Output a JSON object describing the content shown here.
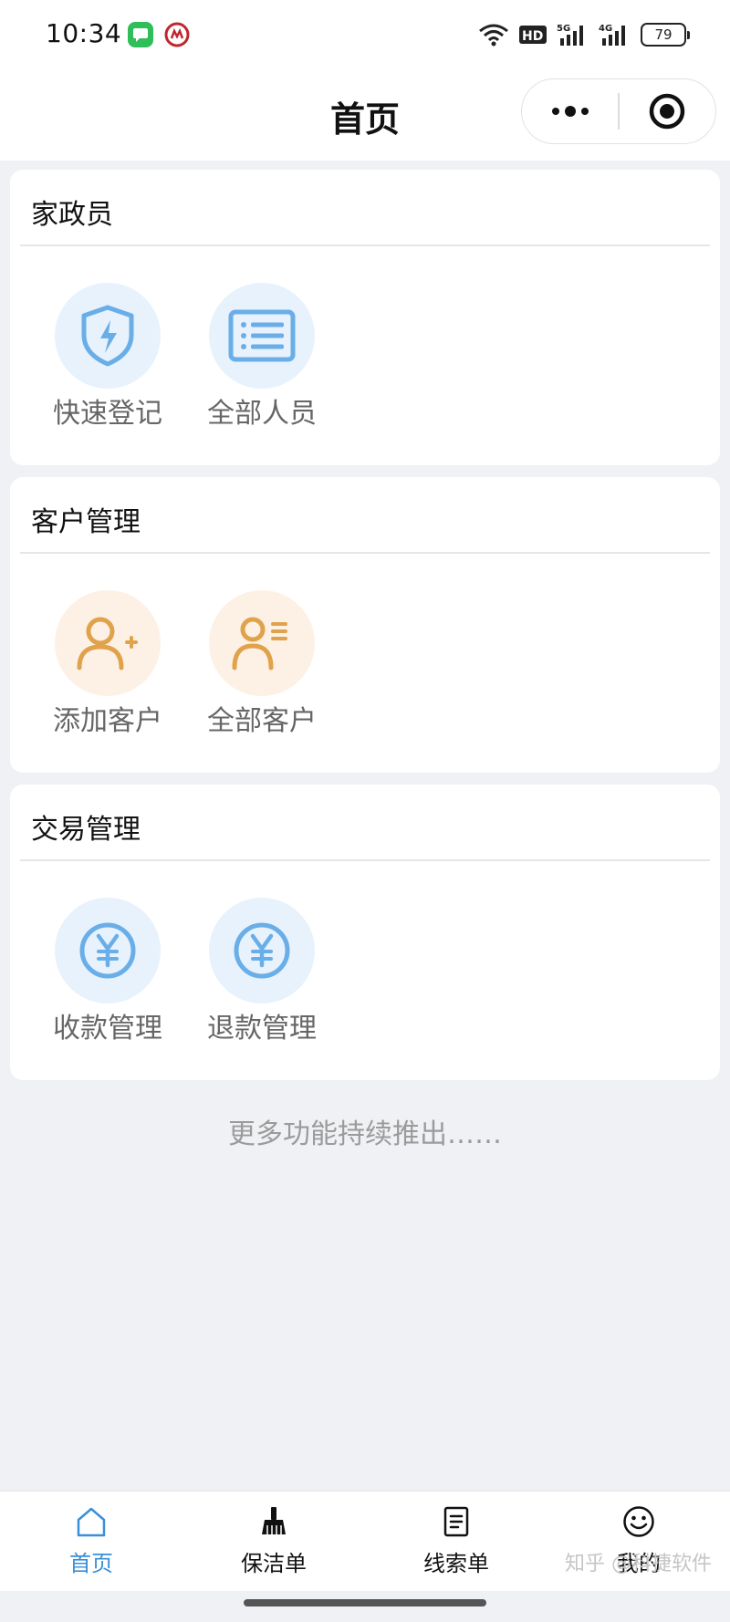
{
  "status_bar": {
    "time": "10:34",
    "battery": "79",
    "icons": [
      "message-app-icon",
      "bank-app-icon",
      "wifi-icon",
      "hd-icon",
      "signal-5g-icon",
      "signal-4g-icon",
      "battery-icon"
    ]
  },
  "nav": {
    "title": "首页",
    "capsule_icons": [
      "more-dots-icon",
      "close-target-icon"
    ]
  },
  "sections": [
    {
      "title": "家政员",
      "items": [
        {
          "label": "快速登记",
          "icon": "shield-bolt-icon",
          "theme": "blue"
        },
        {
          "label": "全部人员",
          "icon": "list-card-icon",
          "theme": "blue"
        }
      ]
    },
    {
      "title": "客户管理",
      "items": [
        {
          "label": "添加客户",
          "icon": "user-add-icon",
          "theme": "orange"
        },
        {
          "label": "全部客户",
          "icon": "user-list-icon",
          "theme": "orange"
        }
      ]
    },
    {
      "title": "交易管理",
      "items": [
        {
          "label": "收款管理",
          "icon": "yen-circle-icon",
          "theme": "blue"
        },
        {
          "label": "退款管理",
          "icon": "yen-circle-icon",
          "theme": "blue"
        }
      ]
    }
  ],
  "footer_note": "更多功能持续推出……",
  "tabs": [
    {
      "label": "首页",
      "icon": "home-icon",
      "active": true
    },
    {
      "label": "保洁单",
      "icon": "broom-icon",
      "active": false
    },
    {
      "label": "线索单",
      "icon": "document-icon",
      "active": false
    },
    {
      "label": "我的",
      "icon": "smiley-icon",
      "active": false
    }
  ],
  "watermark": "知乎 @科捷软件",
  "colors": {
    "accent_blue": "#3a8fd9",
    "icon_blue": "#6aaee8",
    "icon_orange": "#e0a24a",
    "page_bg": "#eff1f4"
  }
}
